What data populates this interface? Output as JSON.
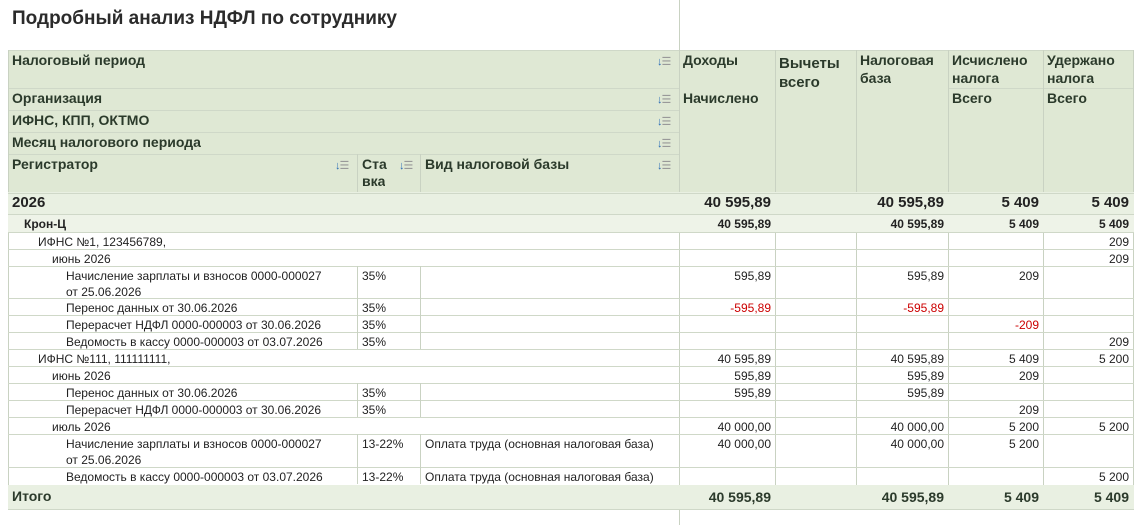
{
  "title": "Подробный анализ НДФЛ по сотруднику",
  "headers": {
    "tax_period": "Налоговый период",
    "organization": "Организация",
    "ifns": "ИФНС, КПП, ОКТМО",
    "month": "Месяц налогового периода",
    "registrar": "Регистратор",
    "rate_1": "Ста",
    "rate_2": "вка",
    "base_type": "Вид налоговой базы",
    "income": "Доходы",
    "income_sub": "Начислено",
    "deductions_1": "Вычеты",
    "deductions_2": "всего",
    "tax_base_1": "Налоговая",
    "tax_base_2": "база",
    "calc_1": "Исчислено",
    "calc_2": "налога",
    "calc_sub": "Всего",
    "withheld_1": "Удержано",
    "withheld_2": "налога",
    "withheld_sub": "Всего"
  },
  "rows": [
    {
      "label": "2026",
      "rate": "",
      "base_type": "",
      "income": "40 595,89",
      "deductions": "",
      "tax_base": "40 595,89",
      "calculated": "5 409",
      "withheld": "5 409"
    },
    {
      "label": "Крон-Ц",
      "rate": "",
      "base_type": "",
      "income": "40 595,89",
      "deductions": "",
      "tax_base": "40 595,89",
      "calculated": "5 409",
      "withheld": "5 409"
    },
    {
      "label": "ИФНС №1, 123456789,",
      "rate": "",
      "base_type": "",
      "income": "",
      "deductions": "",
      "tax_base": "",
      "calculated": "",
      "withheld": "209"
    },
    {
      "label": "июнь 2026",
      "rate": "",
      "base_type": "",
      "income": "",
      "deductions": "",
      "tax_base": "",
      "calculated": "",
      "withheld": "209"
    },
    {
      "label": "Начисление зарплаты и взносов 0000-000027",
      "label2": "от 25.06.2026",
      "rate": "35%",
      "base_type": "",
      "income": "595,89",
      "deductions": "",
      "tax_base": "595,89",
      "calculated": "209",
      "withheld": ""
    },
    {
      "label": "Перенос данных  от 30.06.2026",
      "rate": "35%",
      "base_type": "",
      "income": "-595,89",
      "deductions": "",
      "tax_base": "-595,89",
      "calculated": "",
      "withheld": ""
    },
    {
      "label": "Перерасчет НДФЛ 0000-000003 от 30.06.2026",
      "rate": "35%",
      "base_type": "",
      "income": "",
      "deductions": "",
      "tax_base": "",
      "calculated": "-209",
      "withheld": ""
    },
    {
      "label": "Ведомость в кассу 0000-000003 от 03.07.2026",
      "rate": "35%",
      "base_type": "",
      "income": "",
      "deductions": "",
      "tax_base": "",
      "calculated": "",
      "withheld": "209"
    },
    {
      "label": "ИФНС №111, 111111111,",
      "rate": "",
      "base_type": "",
      "income": "40 595,89",
      "deductions": "",
      "tax_base": "40 595,89",
      "calculated": "5 409",
      "withheld": "5 200"
    },
    {
      "label": "июнь 2026",
      "rate": "",
      "base_type": "",
      "income": "595,89",
      "deductions": "",
      "tax_base": "595,89",
      "calculated": "209",
      "withheld": ""
    },
    {
      "label": "Перенос данных  от 30.06.2026",
      "rate": "35%",
      "base_type": "",
      "income": "595,89",
      "deductions": "",
      "tax_base": "595,89",
      "calculated": "",
      "withheld": ""
    },
    {
      "label": "Перерасчет НДФЛ 0000-000003 от 30.06.2026",
      "rate": "35%",
      "base_type": "",
      "income": "",
      "deductions": "",
      "tax_base": "",
      "calculated": "209",
      "withheld": ""
    },
    {
      "label": "июль 2026",
      "rate": "",
      "base_type": "",
      "income": "40 000,00",
      "deductions": "",
      "tax_base": "40 000,00",
      "calculated": "5 200",
      "withheld": "5 200"
    },
    {
      "label": "Начисление зарплаты и взносов 0000-000027",
      "label2": "от 25.06.2026",
      "rate": "13-22%",
      "base_type": "Оплата труда (основная налоговая база)",
      "income": "40 000,00",
      "deductions": "",
      "tax_base": "40 000,00",
      "calculated": "5 200",
      "withheld": ""
    },
    {
      "label": "Ведомость в кассу 0000-000003 от 03.07.2026",
      "rate": "13-22%",
      "base_type": "Оплата труда (основная налоговая база)",
      "income": "",
      "deductions": "",
      "tax_base": "",
      "calculated": "",
      "withheld": "5 200"
    }
  ],
  "total": {
    "label": "Итого",
    "income": "40 595,89",
    "deductions": "",
    "tax_base": "40 595,89",
    "calculated": "5 409",
    "withheld": "5 409"
  },
  "colors": {
    "header_bg": "#dfe8d4",
    "group_bg": "#e9f0e2",
    "negative": "#cc0000",
    "sort_icon": "#2c6db5"
  }
}
